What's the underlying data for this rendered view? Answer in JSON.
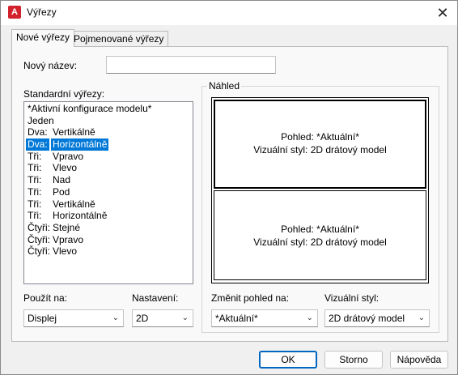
{
  "window": {
    "title": "Výřezy",
    "app_icon": "A",
    "close_glyph": "✕"
  },
  "tabs": [
    {
      "label": "Nové výřezy",
      "active": true
    },
    {
      "label": "Pojmenované výřezy",
      "active": false
    }
  ],
  "new_name": {
    "label": "Nový název:",
    "value": ""
  },
  "standard": {
    "label": "Standardní výřezy:",
    "items": [
      {
        "name": "*Aktivní konfigurace modelu*",
        "detail": ""
      },
      {
        "name": "Jeden",
        "detail": ""
      },
      {
        "name": "Dva:",
        "detail": "Vertikálně"
      },
      {
        "name": "Dva:",
        "detail": "Horizontálně",
        "selected": true
      },
      {
        "name": "Tři:",
        "detail": "Vpravo"
      },
      {
        "name": "Tři:",
        "detail": "Vlevo"
      },
      {
        "name": "Tři:",
        "detail": "Nad"
      },
      {
        "name": "Tři:",
        "detail": "Pod"
      },
      {
        "name": "Tři:",
        "detail": "Vertikálně"
      },
      {
        "name": "Tři:",
        "detail": "Horizontálně"
      },
      {
        "name": "Čtyři:",
        "detail": "Stejné"
      },
      {
        "name": "Čtyři:",
        "detail": "Vpravo"
      },
      {
        "name": "Čtyři:",
        "detail": "Vlevo"
      }
    ]
  },
  "preview": {
    "label": "Náhled",
    "top": {
      "view": "Pohled: *Aktuální*",
      "style": "Vizuální styl: 2D drátový model"
    },
    "bottom": {
      "view": "Pohled: *Aktuální*",
      "style": "Vizuální styl: 2D drátový model"
    }
  },
  "apply_to": {
    "label": "Použít na:",
    "value": "Displej"
  },
  "setup": {
    "label": "Nastavení:",
    "value": "2D"
  },
  "change_view": {
    "label": "Změnit pohled na:",
    "value": "*Aktuální*"
  },
  "visual_style": {
    "label": "Vizuální styl:",
    "value": "2D drátový model"
  },
  "buttons": {
    "ok": "OK",
    "cancel": "Storno",
    "help": "Nápověda"
  },
  "colors": {
    "selection": "#0078d7",
    "default_button_border": "#0067c0",
    "app_icon": "#d2222d"
  }
}
